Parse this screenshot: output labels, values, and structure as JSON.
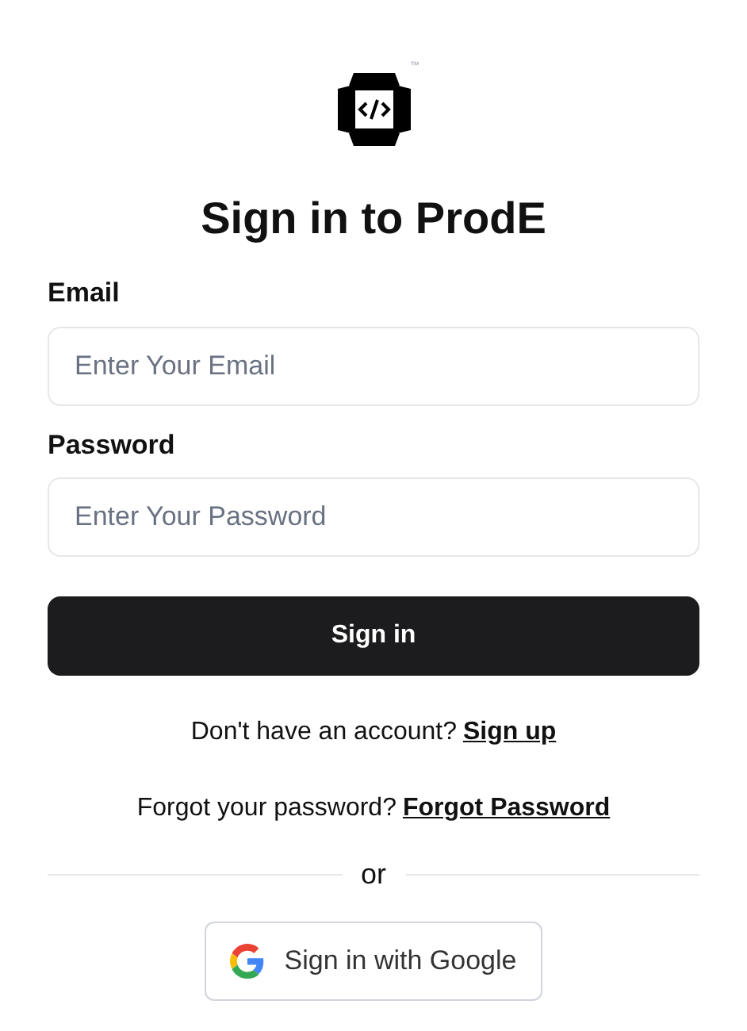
{
  "logo": {
    "trademark": "™"
  },
  "title": "Sign in to ProdE",
  "fields": [
    {
      "label": "Email",
      "placeholder": "Enter Your Email"
    },
    {
      "label": "Password",
      "placeholder": "Enter Your Password"
    }
  ],
  "submit": "Sign in",
  "signup": {
    "text": "Don't have an account?",
    "link": "Sign up"
  },
  "forgot": {
    "text": "Forgot your password?",
    "link": "Forgot Password"
  },
  "divider": "or",
  "google_button": "Sign in with Google"
}
